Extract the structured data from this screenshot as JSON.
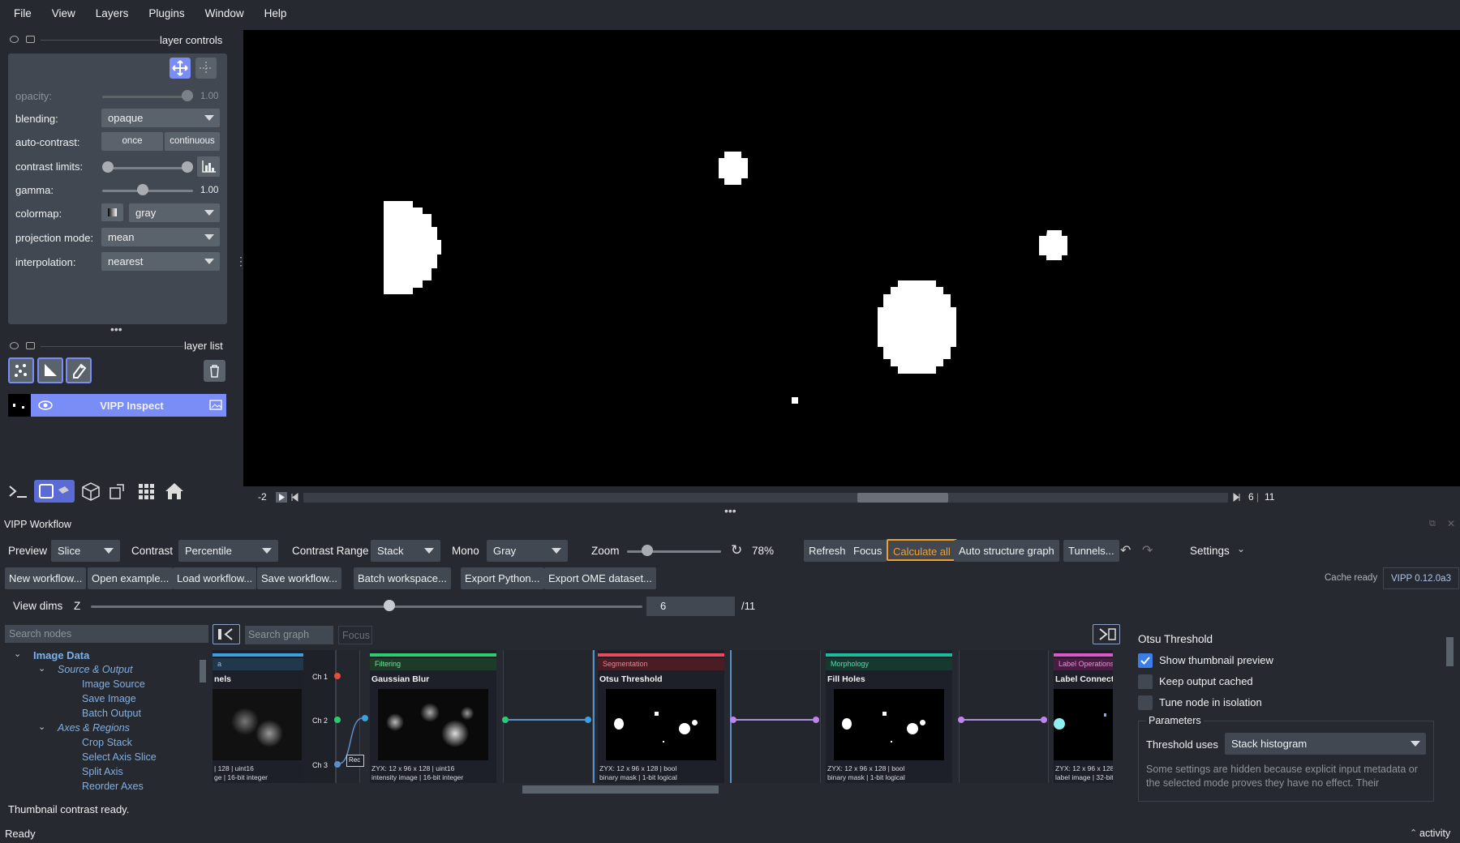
{
  "menu": [
    "File",
    "View",
    "Layers",
    "Plugins",
    "Window",
    "Help"
  ],
  "layer_controls": {
    "title": "layer controls",
    "opacity_label": "opacity:",
    "opacity_value": "1.00",
    "opacity": 1.0,
    "blending_label": "blending:",
    "blending_value": "opaque",
    "autocontrast_label": "auto-contrast:",
    "once_label": "once",
    "continuous_label": "continuous",
    "contrast_label": "contrast limits:",
    "gamma_label": "gamma:",
    "gamma_value": "1.00",
    "colormap_label": "colormap:",
    "colormap_value": "gray",
    "projection_label": "projection mode:",
    "projection_value": "mean",
    "interpolation_label": "interpolation:",
    "interpolation_value": "nearest"
  },
  "layer_list": {
    "title": "layer list",
    "layer_name": "VIPP Inspect"
  },
  "dims": {
    "left_value": "-2",
    "right_value": "6",
    "right_total": "11"
  },
  "workflow": {
    "title": "VIPP Workflow",
    "preview_label": "Preview",
    "preview_value": "Slice",
    "contrast_label": "Contrast",
    "contrast_value": "Percentile",
    "range_label": "Contrast Range",
    "range_value": "Stack",
    "mono_label": "Mono",
    "mono_value": "Gray",
    "zoom_label": "Zoom",
    "zoom_value": "78%",
    "refresh": "Refresh",
    "focus": "Focus",
    "calculate_all": "Calculate all",
    "auto_structure": "Auto structure graph",
    "tunnels": "Tunnels...",
    "settings": "Settings",
    "new_workflow": "New workflow...",
    "open_example": "Open example...",
    "load_workflow": "Load workflow...",
    "save_workflow": "Save workflow...",
    "batch_workspace": "Batch workspace...",
    "export_python": "Export Python...",
    "export_ome": "Export OME dataset...",
    "cache_status": "Cache ready",
    "version": "VIPP 0.12.0a3",
    "view_dims_label": "View dims",
    "z_label": "Z",
    "z_value": "6",
    "z_total": "/11",
    "search_nodes_placeholder": "Search nodes",
    "search_graph_placeholder": "Search graph",
    "graph_focus": "Focus"
  },
  "tree": {
    "category": "Image Data",
    "groups": [
      {
        "name": "Source & Output",
        "items": [
          "Image Source",
          "Save Image",
          "Batch Output"
        ]
      },
      {
        "name": "Axes & Regions",
        "items": [
          "Crop Stack",
          "Select Axis Slice",
          "Split Axis",
          "Reorder Axes"
        ]
      }
    ]
  },
  "nodes": [
    {
      "tag": "a",
      "title": "nels",
      "meta1": "ge | 16-bit integer",
      "meta0": "| 128 | uint16",
      "color": "#3aa0e0"
    },
    {
      "tag": "Filtering",
      "title": "Gaussian Blur",
      "meta0": "ZYX: 12 x 96 x 128 | uint16",
      "meta1": "intensity image | 16-bit integer",
      "color": "#2ecc71"
    },
    {
      "tag": "Segmentation",
      "title": "Otsu Threshold",
      "meta0": "ZYX: 12 x 96 x 128 | bool",
      "meta1": "binary mask | 1-bit logical",
      "color": "#e74c5c"
    },
    {
      "tag": "Morphology",
      "title": "Fill Holes",
      "meta0": "ZYX: 12 x 96 x 128 | bool",
      "meta1": "binary mask | 1-bit logical",
      "color": "#1abc9c"
    },
    {
      "tag": "Label Operations",
      "title": "Label Connectec",
      "meta0": "ZYX: 12 x 96 x 128 |",
      "meta1": "label image | 32-bit",
      "color": "#e056c8"
    }
  ],
  "channels": [
    "Ch 1",
    "Ch 2",
    "Ch 3"
  ],
  "channel_box_label": "Rec",
  "inspector": {
    "title": "Otsu Threshold",
    "show_thumbnail": "Show thumbnail preview",
    "keep_cached": "Keep output cached",
    "tune_isolation": "Tune node in isolation",
    "parameters": "Parameters",
    "threshold_label": "Threshold uses",
    "threshold_value": "Stack histogram",
    "hint": "Some settings are hidden because explicit input metadata or the selected mode proves they have no effect. Their"
  },
  "status_message": "Thumbnail contrast ready.",
  "status_ready": "Ready",
  "activity": "activity",
  "colors": {
    "accent": "#7a8cf5",
    "calculate": "#f0a030",
    "bg": "#262930",
    "panel": "#414851"
  }
}
